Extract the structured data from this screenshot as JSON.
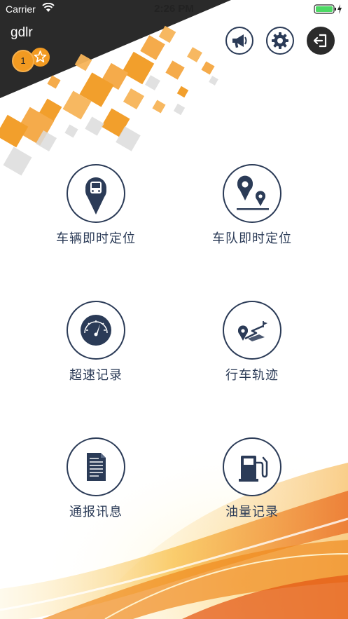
{
  "status_bar": {
    "carrier": "Carrier",
    "time": "2:26 PM"
  },
  "user": {
    "name": "gdlr",
    "level": "1"
  },
  "top_actions": [
    {
      "id": "announcement",
      "icon": "megaphone-icon"
    },
    {
      "id": "settings",
      "icon": "gear-icon"
    },
    {
      "id": "logout",
      "icon": "logout-icon"
    }
  ],
  "menu": {
    "vehicle_location": {
      "label": "车辆即时定位",
      "icon": "bus-pin-icon"
    },
    "fleet_location": {
      "label": "车队即时定位",
      "icon": "map-pins-icon"
    },
    "speeding_record": {
      "label": "超速记录",
      "icon": "speedometer-icon"
    },
    "driving_track": {
      "label": "行车轨迹",
      "icon": "route-icon"
    },
    "notifications": {
      "label": "通报讯息",
      "icon": "document-icon"
    },
    "fuel_record": {
      "label": "油量记录",
      "icon": "fuel-pump-icon"
    }
  },
  "colors": {
    "accent": "#f29a21",
    "primary": "#2b3b57",
    "header_dark": "#2a2a2a"
  }
}
